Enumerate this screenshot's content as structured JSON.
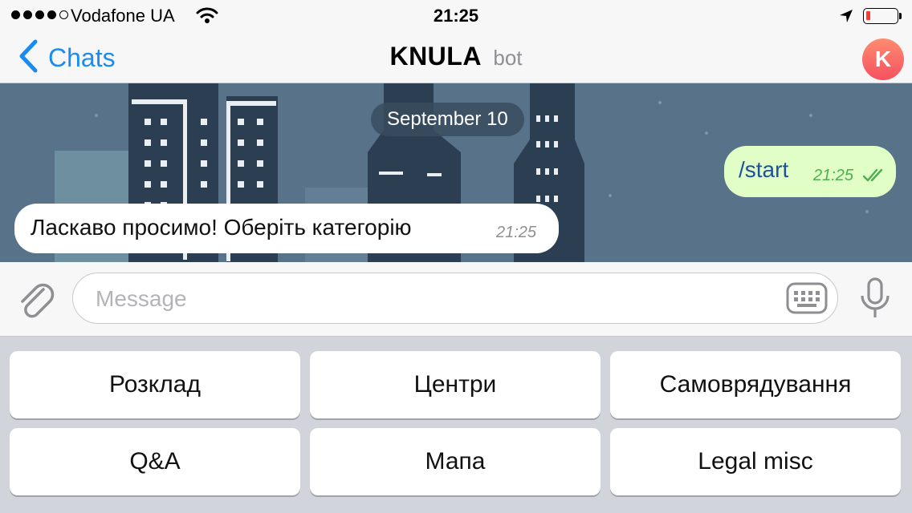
{
  "status_bar": {
    "carrier": "Vodafone UA",
    "time": "21:25",
    "signal_bars": 4,
    "signal_total": 5,
    "battery_level_fraction": 0.15
  },
  "nav": {
    "back_label": "Chats",
    "title": "KNULA",
    "subtitle": "bot",
    "avatar_letter": "K"
  },
  "chat": {
    "date_separator": "September 10",
    "messages": [
      {
        "direction": "outgoing",
        "text": "/start",
        "time": "21:25",
        "read": true
      },
      {
        "direction": "incoming",
        "text": "Ласкаво просимо! Оберіть категорію",
        "time": "21:25"
      }
    ]
  },
  "input": {
    "placeholder": "Message",
    "value": ""
  },
  "keyboard": {
    "buttons": [
      "Розклад",
      "Центри",
      "Самоврядування",
      "Q&A",
      "Мапа",
      "Legal misc"
    ]
  },
  "colors": {
    "accent": "#1a8cf0",
    "chat_background": "#58728a",
    "outgoing_bubble": "#e1fec6",
    "incoming_bubble": "#ffffff",
    "avatar": "#f5515f",
    "battery_low": "#ff3b30"
  },
  "icons": {
    "back": "chevron-left-icon",
    "wifi": "wifi-icon",
    "location": "location-arrow-icon",
    "battery": "battery-icon",
    "attach": "paperclip-icon",
    "keyboard": "keyboard-icon",
    "mic": "microphone-icon",
    "read_receipt": "double-check-icon"
  }
}
